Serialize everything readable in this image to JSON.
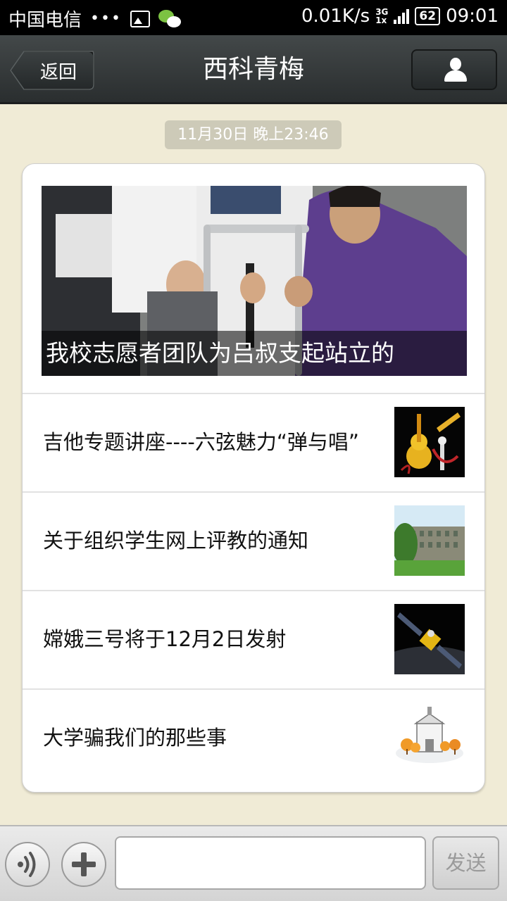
{
  "status_bar": {
    "carrier": "中国电信",
    "dots": "•••",
    "net_speed": "0.01K/s",
    "signal_type_top": "3G",
    "signal_type_bottom": "1x",
    "battery": "62",
    "time": "09:01",
    "icons": [
      "image-notification-icon",
      "wechat-notification-icon",
      "signal-bars-icon",
      "battery-icon"
    ]
  },
  "header": {
    "back_label": "返回",
    "title": "西科青梅",
    "profile_icon": "user-profile-icon"
  },
  "timestamp": "11月30日 晚上23:46",
  "article": {
    "cover_caption": "我校志愿者团队为吕叔支起站立的",
    "items": [
      {
        "title": "吉他专题讲座----六弦魅力“弹与唱”",
        "thumbnail": "guitar-poster"
      },
      {
        "title": "关于组织学生网上评教的通知",
        "thumbnail": "campus-building-photo"
      },
      {
        "title": "嫦娥三号将于12月2日发射",
        "thumbnail": "satellite-image"
      },
      {
        "title": "大学骗我们的那些事",
        "thumbnail": "university-illustration"
      }
    ]
  },
  "input_bar": {
    "voice_icon": "voice-icon",
    "plus_icon": "plus-icon",
    "input_value": "",
    "send_label": "发送"
  },
  "colors": {
    "background": "#f0ebd6",
    "header_bg": "#343839",
    "timestamp_bg": "#cdcab8"
  }
}
